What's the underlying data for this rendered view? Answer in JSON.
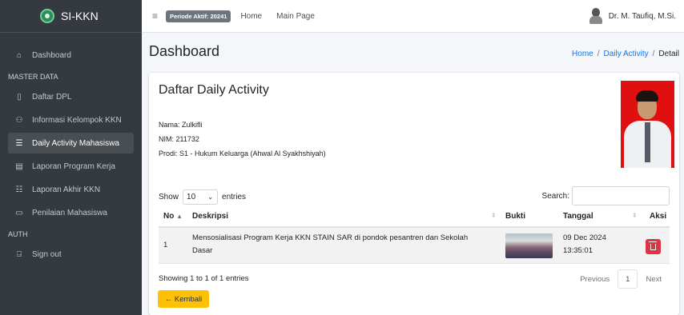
{
  "brand": {
    "name": "SI-KKN"
  },
  "sidebar": {
    "items": [
      {
        "label": "Dashboard",
        "icon": "home-icon"
      },
      {
        "header": "MASTER DATA"
      },
      {
        "label": "Daftar DPL",
        "icon": "book-icon"
      },
      {
        "label": "Informasi Kelompok KKN",
        "icon": "users-icon"
      },
      {
        "label": "Daily Activity Mahasiswa",
        "icon": "list-icon",
        "active": true
      },
      {
        "label": "Laporan Program Kerja",
        "icon": "file-icon"
      },
      {
        "label": "Laporan Akhir KKN",
        "icon": "checklist-icon"
      },
      {
        "label": "Penilaian Mahasiswa",
        "icon": "file-icon"
      },
      {
        "header": "AUTH"
      },
      {
        "label": "Sign out",
        "icon": "signout-icon"
      }
    ]
  },
  "topbar": {
    "period_badge": "Periode Aktif: 20241",
    "links": [
      "Home",
      "Main Page"
    ],
    "user_name": "Dr. M. Taufiq, M.Si."
  },
  "page": {
    "title": "Dashboard",
    "breadcrumb": [
      "Home",
      "Daily Activity",
      "Detail"
    ]
  },
  "card": {
    "title": "Daftar Daily Activity",
    "nama": "Nama: Zulkifli",
    "nim": "NIM: 211732",
    "prodi": "Prodi: S1 - Hukum Keluarga (Ahwal Al Syakhshiyah)"
  },
  "table": {
    "show_label": "Show",
    "entries_value": "10",
    "entries_label": "entries",
    "search_label": "Search:",
    "columns": [
      "No",
      "Deskripsi",
      "Bukti",
      "Tanggal",
      "Aksi"
    ],
    "rows": [
      {
        "no": "1",
        "deskripsi_line1": "Mensosialisasi Program Kerja KKN STAIN SAR di pondok pesantren dan Sekolah",
        "deskripsi_line2": "Dasar",
        "tanggal_date": "09 Dec 2024",
        "tanggal_time": "13:35:01"
      }
    ],
    "info": "Showing 1 to 1 of 1 entries",
    "pager": {
      "previous": "Previous",
      "page": "1",
      "next": "Next"
    }
  },
  "back_button": "← Kembali",
  "colors": {
    "sidebar": "#343a40",
    "accent": "#007bff",
    "danger": "#dc3545",
    "warning": "#ffc107"
  }
}
